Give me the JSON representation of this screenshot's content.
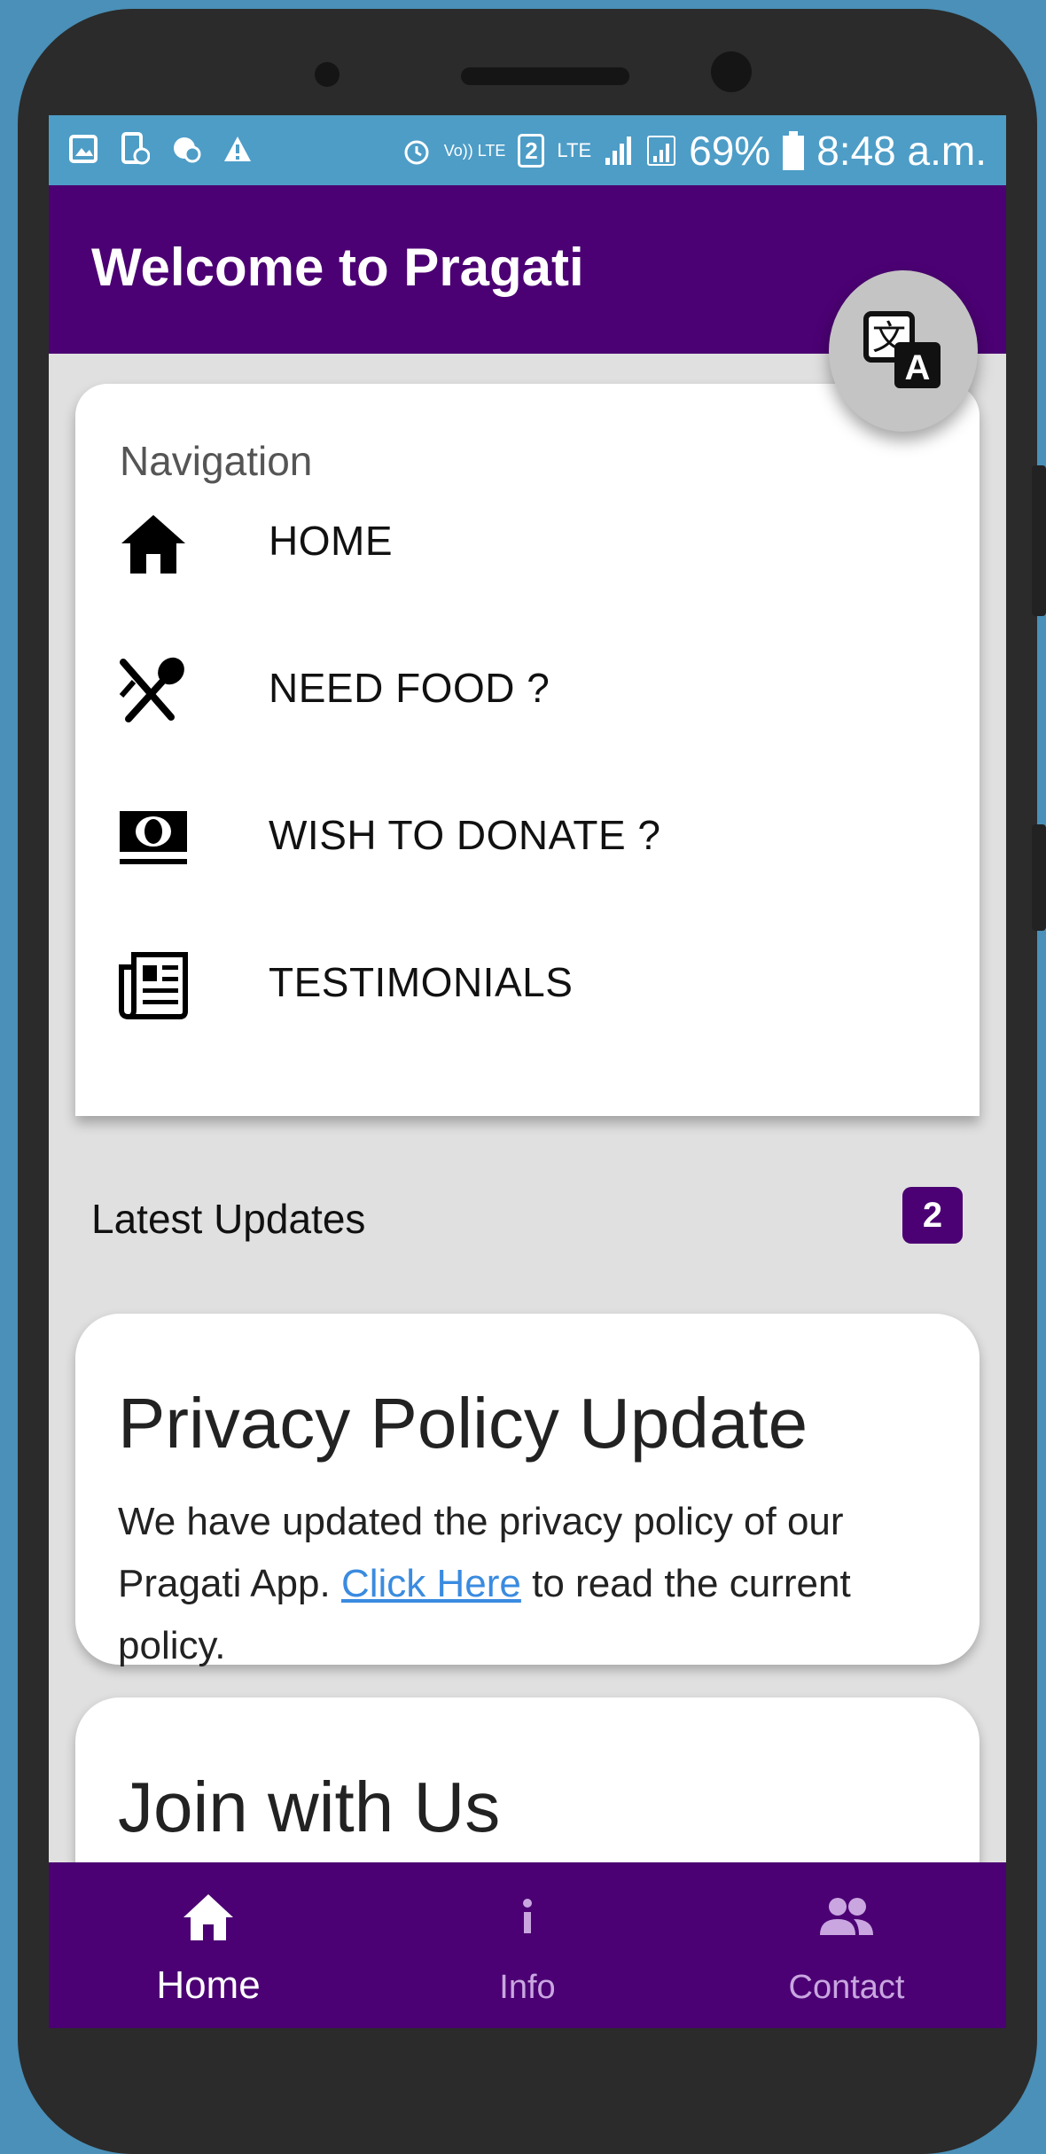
{
  "status_bar": {
    "battery": "69%",
    "time": "8:48 a.m.",
    "sim_slot": "2",
    "network_type": "LTE",
    "volte": "Vo)) LTE"
  },
  "app_bar": {
    "title": "Welcome to Pragati",
    "translate_icon": "translate-icon"
  },
  "navigation": {
    "heading": "Navigation",
    "items": [
      {
        "label": "HOME",
        "icon": "home-icon"
      },
      {
        "label": "NEED FOOD ?",
        "icon": "utensils-icon"
      },
      {
        "label": "WISH TO DONATE ?",
        "icon": "money-icon"
      },
      {
        "label": "TESTIMONIALS",
        "icon": "newspaper-icon"
      }
    ]
  },
  "updates": {
    "label": "Latest Updates",
    "count": "2",
    "cards": [
      {
        "title": "Privacy Policy Update",
        "body_prefix": "We have updated the privacy policy of our Pragati App.",
        "link_text": "Click Here",
        "body_suffix": "to read the current policy."
      },
      {
        "title": "Join with Us"
      }
    ]
  },
  "bottom_nav": {
    "tabs": [
      {
        "label": "Home",
        "icon": "home-icon",
        "active": true
      },
      {
        "label": "Info",
        "icon": "info-icon",
        "active": false
      },
      {
        "label": "Contact",
        "icon": "people-icon",
        "active": false
      }
    ]
  },
  "colors": {
    "primary": "#4b0073",
    "status_bar": "#4d9dc7",
    "background": "#e0e0e0",
    "link": "#3a8be0"
  }
}
